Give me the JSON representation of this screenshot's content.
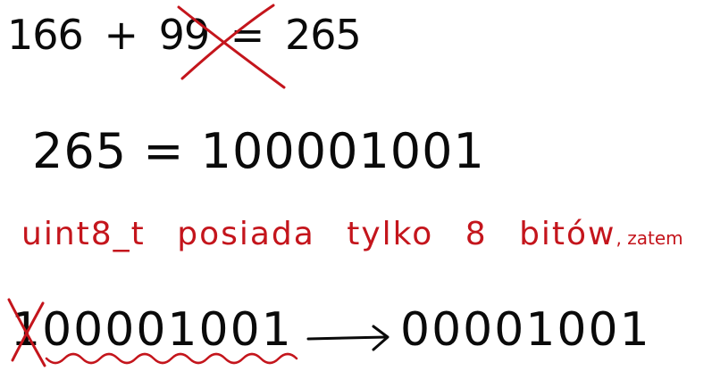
{
  "equation": {
    "lhs_a": "166",
    "plus": "+",
    "lhs_b": "99",
    "equals": "=",
    "result": "265"
  },
  "binary_line": {
    "decimal": "265",
    "equals": "=",
    "binary": "100001001"
  },
  "note": {
    "text_main": "uint8_t posiada tylko 8 bitów",
    "text_tail": ", zatem"
  },
  "truncation": {
    "dropped_bit": "1",
    "kept_bits": "00001001",
    "result": "00001001"
  },
  "colors": {
    "ink": "#0a0a0a",
    "red": "#c4151c"
  }
}
